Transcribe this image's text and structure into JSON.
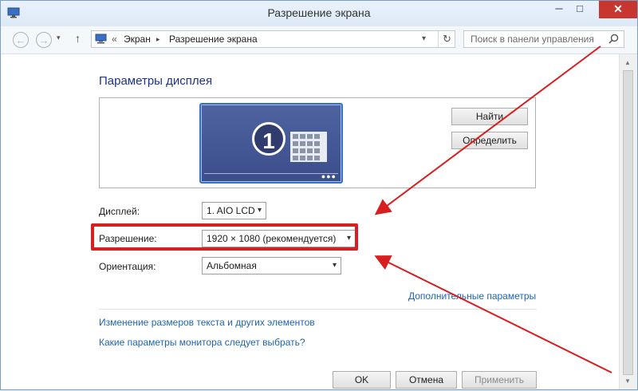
{
  "window": {
    "title": "Разрешение экрана",
    "min_glyph": "─",
    "max_glyph": "□",
    "close_glyph": "✕"
  },
  "nav": {
    "breadcrumb_chevron": "«",
    "breadcrumb": [
      "Экран",
      "Разрешение экрана"
    ],
    "breadcrumb_separator": "▸",
    "search_placeholder": "Поиск в панели управления"
  },
  "main": {
    "section_title": "Параметры дисплея",
    "monitor_number": "1",
    "find_button": "Найти",
    "detect_button": "Определить",
    "display_label": "Дисплей:",
    "display_value": "1. AIO LCD",
    "resolution_label": "Разрешение:",
    "resolution_value": "1920 × 1080 (рекомендуется)",
    "orientation_label": "Ориентация:",
    "orientation_value": "Альбомная",
    "advanced_link": "Дополнительные параметры",
    "text_size_link": "Изменение размеров текста и других элементов",
    "which_settings_link": "Какие параметры монитора следует выбрать?"
  },
  "footer": {
    "ok": "OK",
    "cancel": "Отмена",
    "apply": "Применить"
  },
  "colors": {
    "highlight": "#d81e1e",
    "link": "#1e65b4",
    "heading": "#1e3287",
    "close_button": "#c7372f"
  },
  "icons": [
    "back-arrow-icon",
    "forward-arrow-icon",
    "up-arrow-icon",
    "monitor-icon",
    "refresh-icon",
    "search-icon",
    "chevron-down-icon"
  ]
}
